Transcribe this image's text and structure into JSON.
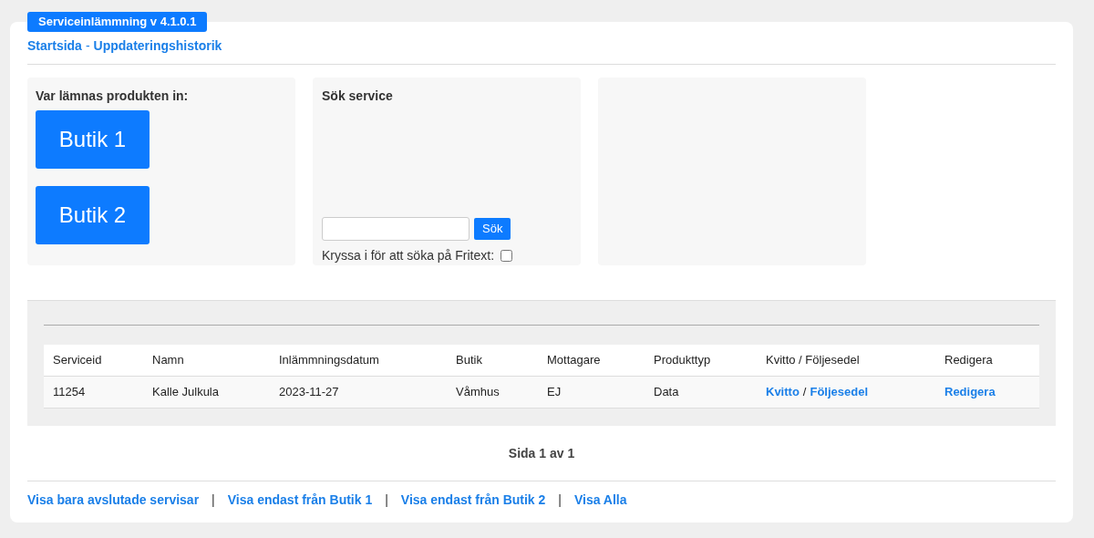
{
  "header": {
    "badge": "Serviceinlämmning v 4.1.0.1",
    "breadcrumb": [
      {
        "label": "Startsida"
      },
      {
        "label": "Uppdateringshistorik"
      }
    ],
    "breadcrumb_separator": "-"
  },
  "store_panel": {
    "title": "Var lämnas produkten in:",
    "buttons": [
      "Butik 1",
      "Butik 2"
    ]
  },
  "search_panel": {
    "title": "Sök service",
    "button": "Sök",
    "checkbox_label": "Kryssa i för att söka på Fritext:",
    "checked": false
  },
  "table": {
    "columns": [
      "Serviceid",
      "Namn",
      "Inlämmningsdatum",
      "Butik",
      "Mottagare",
      "Produkttyp",
      "Kvitto / Följesedel",
      "Redigera"
    ],
    "rows": [
      {
        "serviceid": "11254",
        "namn": "Kalle Julkula",
        "datum": "2023-11-27",
        "butik": "Våmhus",
        "mottagare": "EJ",
        "produkttyp": "Data",
        "kvitto": "Kvitto",
        "separator": "/",
        "foljesedel": "Följesedel",
        "redigera": "Redigera"
      }
    ]
  },
  "pagination": "Sida 1 av 1",
  "filters": [
    {
      "label": "Visa bara avslutade servisar"
    },
    {
      "label": "Visa endast från Butik 1"
    },
    {
      "label": "Visa endast från Butik 2"
    },
    {
      "label": "Visa Alla"
    }
  ],
  "filter_separator": "|"
}
